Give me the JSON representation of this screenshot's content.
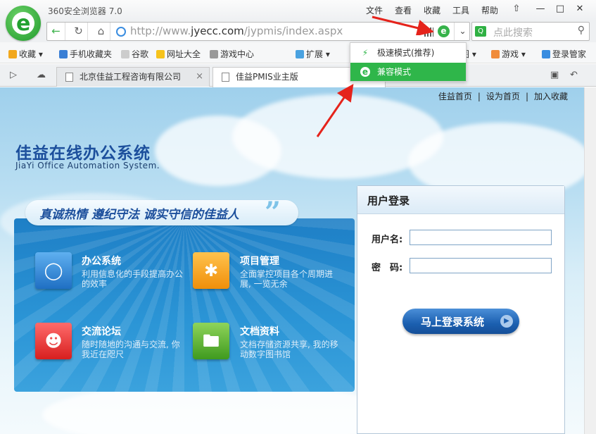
{
  "browser": {
    "title": "360安全浏览器 7.0",
    "menus": [
      "文件",
      "查看",
      "收藏",
      "工具",
      "帮助"
    ],
    "window_buttons": [
      "↑",
      "—",
      "□",
      "✕"
    ]
  },
  "address": {
    "url_prefix": "http://www.",
    "url_domain": "jyecc.com",
    "url_path": "/jypmis/index.aspx",
    "mode_icon": "e",
    "search_placeholder": "点此搜索"
  },
  "bookmarks": [
    {
      "label": "收藏 ▾",
      "icon": "star-icon",
      "color": "#f2a81d"
    },
    {
      "label": "手机收藏夹",
      "icon": "phone-icon",
      "color": "#3a7fd5"
    },
    {
      "label": "谷歌",
      "icon": "page-icon",
      "color": "#cccccc"
    },
    {
      "label": "网址大全",
      "icon": "plus-icon",
      "color": "#f6c31c"
    },
    {
      "label": "游戏中心",
      "icon": "gamepad-icon",
      "color": "#999999"
    },
    {
      "label": "扩展 ▾",
      "icon": "extension-icon",
      "color": "#4aa2e0"
    },
    {
      "label": "图 ▾",
      "icon": "image-icon",
      "color": "#36b24a"
    },
    {
      "label": "游戏 ▾",
      "icon": "game-icon",
      "color": "#f08c3a"
    },
    {
      "label": "登录管家",
      "icon": "key-icon",
      "color": "#3a8de0"
    }
  ],
  "dropdown": {
    "items": [
      {
        "label": "极速模式(推荐)",
        "icon": "lightning-icon",
        "selected": false
      },
      {
        "label": "兼容模式",
        "icon": "ie-icon",
        "selected": true
      }
    ]
  },
  "tabs": [
    {
      "label": "北京佳益工程咨询有限公司",
      "active": false
    },
    {
      "label": "佳益PMIS业主版",
      "active": true
    }
  ],
  "page": {
    "top_links": [
      "佳益首页",
      "设为首页",
      "加入收藏"
    ],
    "system_title": "佳益在线办公系统",
    "system_subtitle": "JiaYi Office Automation System.",
    "slogan": "真诚热情 遵纪守法 诚实守信的佳益人",
    "features": [
      {
        "title": "办公系统",
        "desc": "利用信息化的手段提高办公的效率",
        "icon": "chat-icon",
        "color": "#2d7fd0"
      },
      {
        "title": "项目管理",
        "desc": "全面掌控项目各个周期进展, 一览无余",
        "icon": "asterisk-icon",
        "color": "#f5a623"
      },
      {
        "title": "交流论坛",
        "desc": "随时随地的沟通与交流, 你我近在咫尺",
        "icon": "users-icon",
        "color": "#e3342f"
      },
      {
        "title": "文档资料",
        "desc": "文档存储资源共享, 我的移动数字图书馆",
        "icon": "folder-icon",
        "color": "#4caf2a"
      }
    ],
    "login": {
      "title": "用户登录",
      "username_label": "用户名:",
      "username_value": "",
      "password_label": "密　码:",
      "password_value": "",
      "submit_label": "马上登录系统"
    }
  }
}
